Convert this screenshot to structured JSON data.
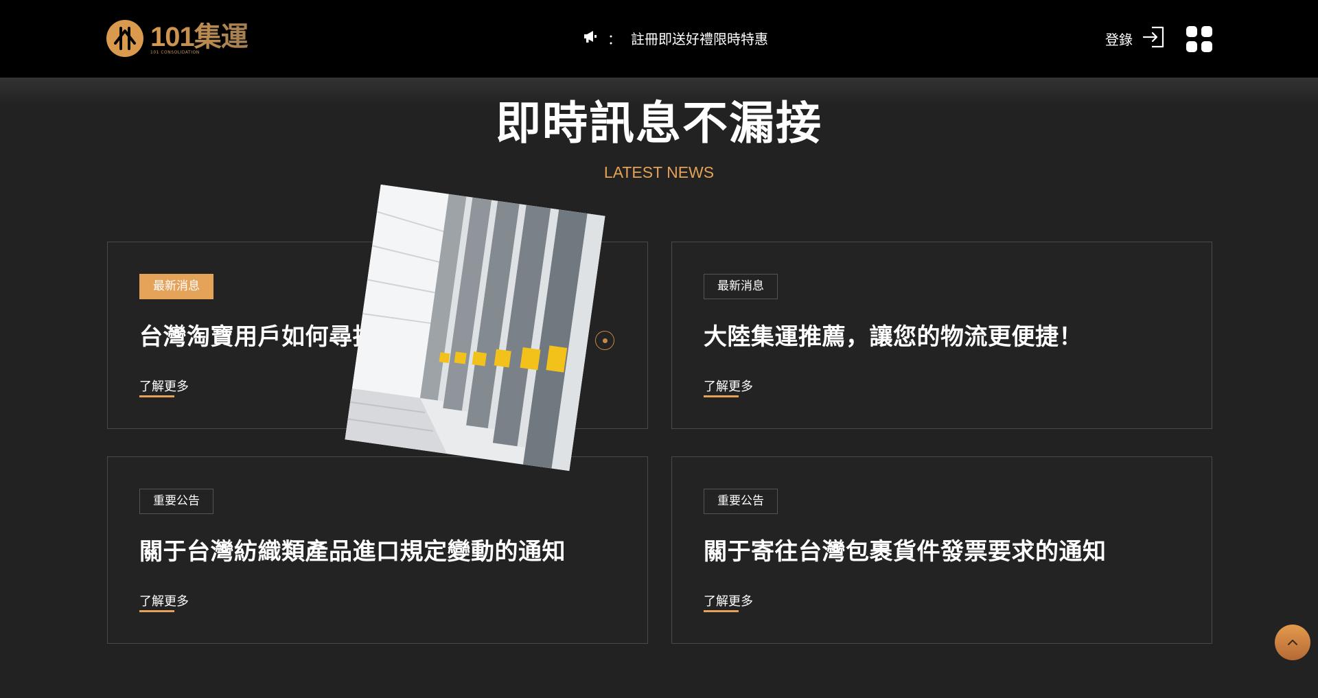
{
  "header": {
    "logo_title": "101集運",
    "logo_subtitle": "101 CONSOLIDATION",
    "announcement": "註冊即送好禮限時特惠",
    "announcement_colon": "：",
    "login_label": "登錄"
  },
  "section": {
    "title": "即時訊息不漏接",
    "subtitle": "LATEST NEWS"
  },
  "news": [
    {
      "tag": "最新消息",
      "title": "台灣淘寶用戶如何尋找",
      "more": "了解更多",
      "active": true
    },
    {
      "tag": "最新消息",
      "title": "大陸集運推薦，讓您的物流更便捷！",
      "more": "了解更多",
      "active": false
    },
    {
      "tag": "重要公告",
      "title": "關于台灣紡織類產品進口規定變動的通知",
      "more": "了解更多",
      "active": false
    },
    {
      "tag": "重要公告",
      "title": "關于寄往台灣包裹貨件發票要求的通知",
      "more": "了解更多",
      "active": false
    }
  ],
  "icons": {
    "announce": "megaphone-icon",
    "login": "login-icon",
    "menu": "grid-menu-icon",
    "back_to_top": "chevron-up-icon"
  },
  "colors": {
    "accent": "#e4a359",
    "background": "#222222",
    "header": "#000000"
  }
}
